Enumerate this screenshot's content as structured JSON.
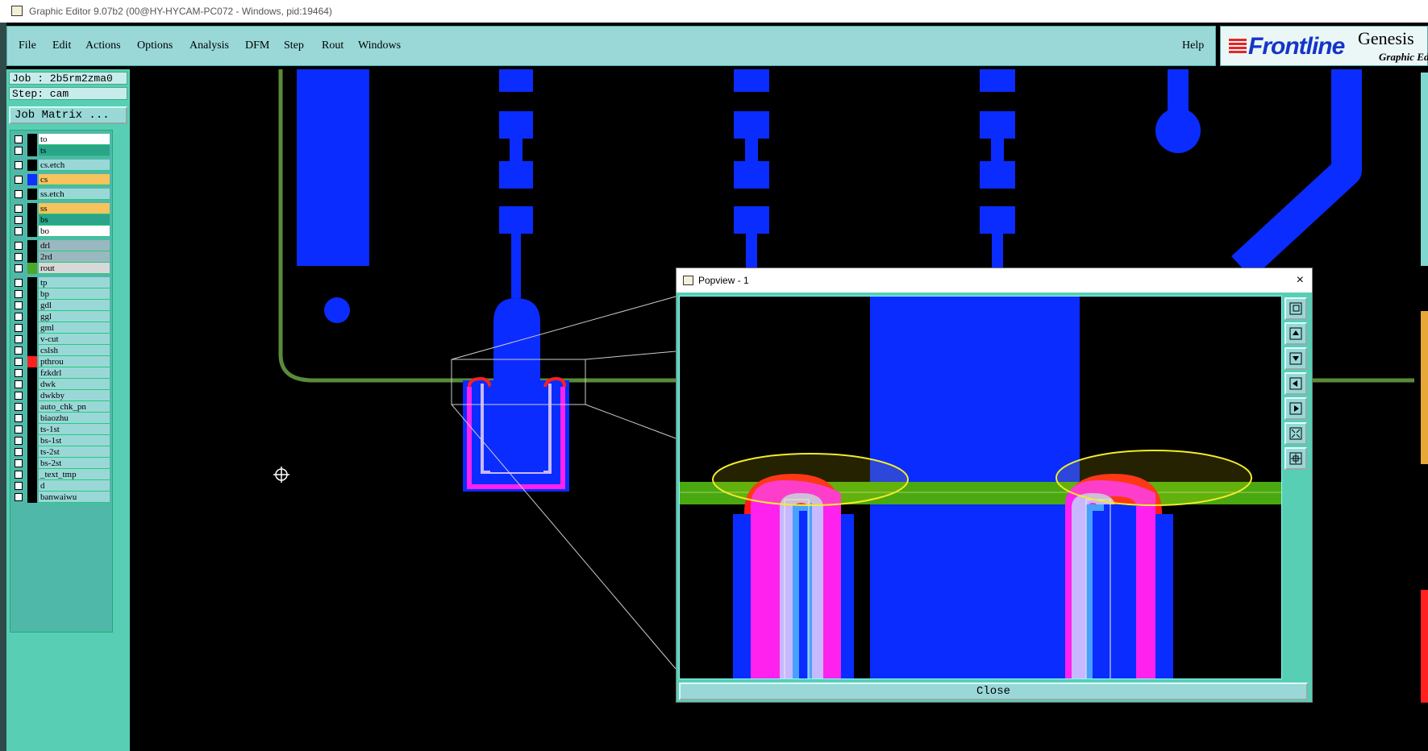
{
  "window": {
    "title": "Graphic Editor 9.07b2 (00@HY-HYCAM-PC072 - Windows, pid:19464)"
  },
  "menu": {
    "items": [
      "File",
      "Edit",
      "Actions",
      "Options",
      "Analysis",
      "DFM",
      "Step",
      "Rout",
      "Windows"
    ],
    "help": "Help"
  },
  "branding": {
    "logo": "Frontline",
    "product": "Genesis",
    "subtitle": "Graphic Ed"
  },
  "job": {
    "job": "Job : 2b5rm2zma0",
    "step": "Step: cam",
    "matrix_button": "Job Matrix ..."
  },
  "layers": [
    {
      "name": "to",
      "color": "#ffffff",
      "swatch": ""
    },
    {
      "name": "ts",
      "color": "#2aa58a",
      "swatch": ""
    },
    {
      "name": "cs.etch",
      "color": "#9ad8d8",
      "swatch": ""
    },
    {
      "name": "cs",
      "color": "#f6c35c",
      "swatch": "#1030ff"
    },
    {
      "name": "ss.etch",
      "color": "#9ad8d8",
      "swatch": ""
    },
    {
      "name": "ss",
      "color": "#f6c35c",
      "swatch": ""
    },
    {
      "name": "bs",
      "color": "#2aa58a",
      "swatch": ""
    },
    {
      "name": "bo",
      "color": "#ffffff",
      "swatch": ""
    },
    {
      "name": "drl",
      "color": "#9ab8c0",
      "swatch": ""
    },
    {
      "name": "2rd",
      "color": "#9ab8c0",
      "swatch": ""
    },
    {
      "name": "rout",
      "color": "#d8d8d8",
      "swatch": "#4aa82a"
    },
    {
      "name": "tp",
      "color": "#9ad8d8",
      "swatch": ""
    },
    {
      "name": "bp",
      "color": "#9ad8d8",
      "swatch": ""
    },
    {
      "name": "gdl",
      "color": "#9ad8d8",
      "swatch": ""
    },
    {
      "name": "ggl",
      "color": "#9ad8d8",
      "swatch": ""
    },
    {
      "name": "gml",
      "color": "#9ad8d8",
      "swatch": ""
    },
    {
      "name": "v-cut",
      "color": "#9ad8d8",
      "swatch": ""
    },
    {
      "name": "cslsh",
      "color": "#9ad8d8",
      "swatch": ""
    },
    {
      "name": "pthrou",
      "color": "#9ad8d8",
      "swatch": "#ff2020"
    },
    {
      "name": "fzkdrl",
      "color": "#9ad8d8",
      "swatch": ""
    },
    {
      "name": "dwk",
      "color": "#9ad8d8",
      "swatch": ""
    },
    {
      "name": "dwkby",
      "color": "#9ad8d8",
      "swatch": ""
    },
    {
      "name": "auto_chk_pn",
      "color": "#9ad8d8",
      "swatch": ""
    },
    {
      "name": "biaozhu",
      "color": "#9ad8d8",
      "swatch": ""
    },
    {
      "name": "ts-1st",
      "color": "#9ad8d8",
      "swatch": ""
    },
    {
      "name": "bs-1st",
      "color": "#9ad8d8",
      "swatch": ""
    },
    {
      "name": "ts-2st",
      "color": "#9ad8d8",
      "swatch": ""
    },
    {
      "name": "bs-2st",
      "color": "#9ad8d8",
      "swatch": ""
    },
    {
      "name": "_text_tmp",
      "color": "#9ad8d8",
      "swatch": ""
    },
    {
      "name": "d",
      "color": "#9ad8d8",
      "swatch": ""
    },
    {
      "name": "banwaiwu",
      "color": "#9ad8d8",
      "swatch": ""
    }
  ],
  "popview": {
    "title": "Popview - 1",
    "close_label": "Close",
    "close_icon": "×"
  }
}
